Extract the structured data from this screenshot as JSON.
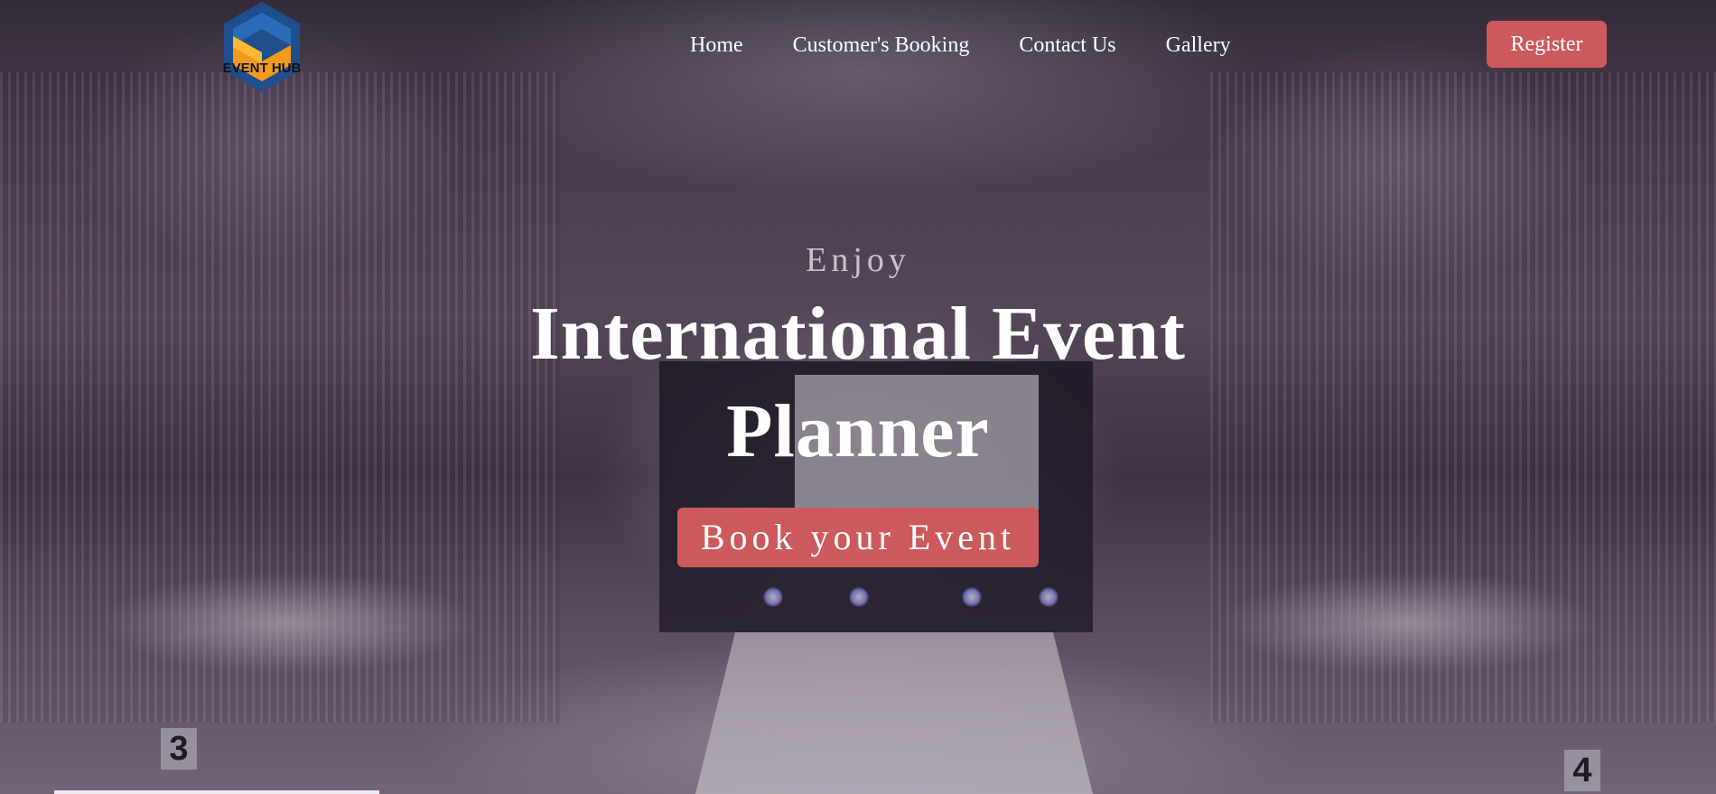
{
  "header": {
    "logo_text": "EVENT HUB",
    "nav_items": [
      {
        "label": "Home"
      },
      {
        "label": "Customer's Booking"
      },
      {
        "label": "Contact Us"
      },
      {
        "label": "Gallery"
      }
    ],
    "register_label": "Register"
  },
  "hero": {
    "kicker": "Enjoy",
    "headline_line1": "International Event",
    "headline_line2": "Planner",
    "cta_label": "Book your Event"
  },
  "scene": {
    "table_numbers": [
      "3",
      "4"
    ]
  },
  "colors": {
    "accent": "#cc5a5c",
    "text": "#ffffff",
    "logo_blue": "#1f4e8c",
    "logo_orange": "#f39a1e"
  }
}
